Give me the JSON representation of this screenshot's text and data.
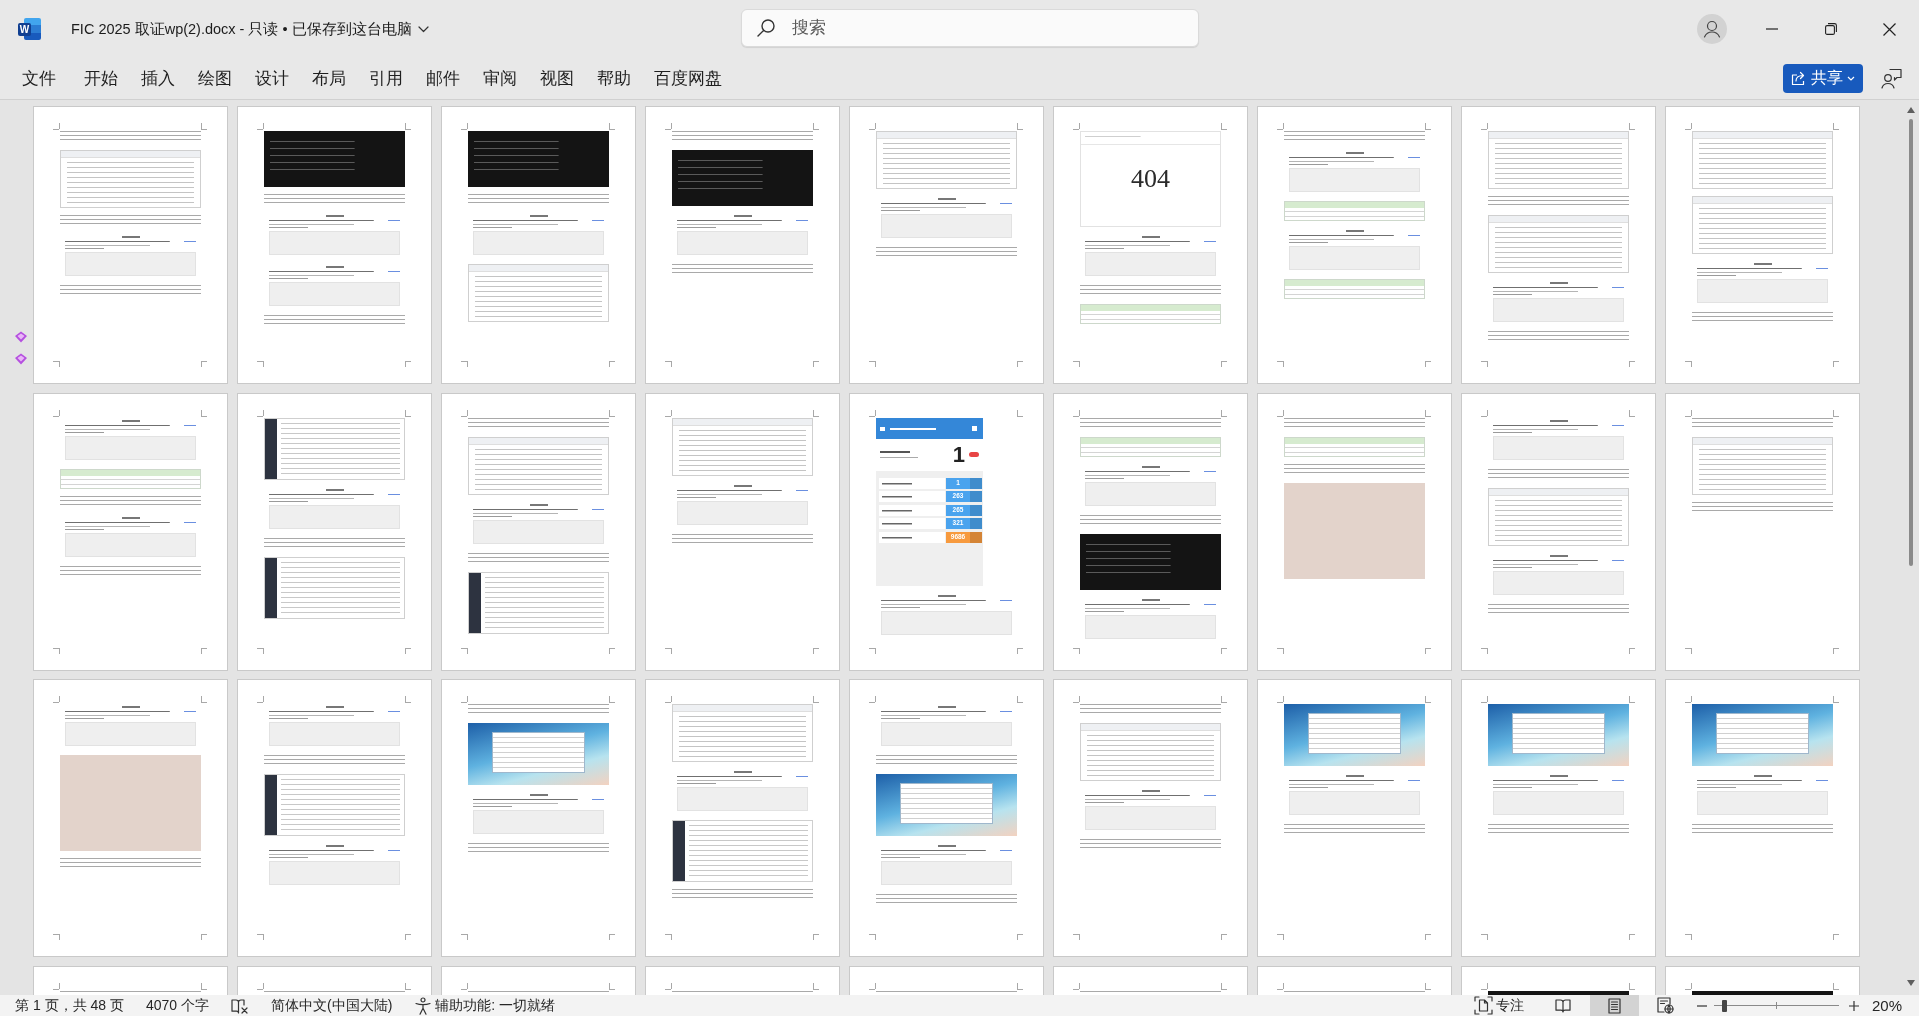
{
  "window": {
    "logo": "W",
    "title": "FIC 2025 取证wp(2).docx - 只读 • 已保存到这台电脑"
  },
  "search": {
    "placeholder": "搜索"
  },
  "ribbon": {
    "tabs": [
      {
        "label": "文件",
        "selected": false
      },
      {
        "label": "开始",
        "selected": false
      },
      {
        "label": "插入",
        "selected": false
      },
      {
        "label": "绘图",
        "selected": false
      },
      {
        "label": "设计",
        "selected": false
      },
      {
        "label": "布局",
        "selected": false
      },
      {
        "label": "引用",
        "selected": false
      },
      {
        "label": "邮件",
        "selected": false
      },
      {
        "label": "审阅",
        "selected": false
      },
      {
        "label": "视图",
        "selected": false
      },
      {
        "label": "帮助",
        "selected": false
      },
      {
        "label": "百度网盘",
        "selected": false
      }
    ],
    "share": "共享"
  },
  "document": {
    "pages": [
      {
        "blocks": [
          {
            "kind": "text"
          },
          {
            "kind": "shot"
          },
          {
            "kind": "text"
          },
          {
            "kind": "quiz"
          },
          {
            "kind": "text"
          }
        ]
      },
      {
        "blocks": [
          {
            "kind": "dark"
          },
          {
            "kind": "text"
          },
          {
            "kind": "quiz"
          },
          {
            "kind": "quiz"
          },
          {
            "kind": "text"
          }
        ]
      },
      {
        "blocks": [
          {
            "kind": "dark"
          },
          {
            "kind": "text"
          },
          {
            "kind": "quiz"
          },
          {
            "kind": "shot"
          }
        ]
      },
      {
        "blocks": [
          {
            "kind": "text"
          },
          {
            "kind": "dark"
          },
          {
            "kind": "quiz"
          },
          {
            "kind": "text"
          }
        ]
      },
      {
        "blocks": [
          {
            "kind": "shot"
          },
          {
            "kind": "quiz"
          },
          {
            "kind": "text"
          }
        ]
      },
      {
        "blocks": [
          {
            "kind": "error",
            "text": "404"
          },
          {
            "kind": "quiz"
          },
          {
            "kind": "text"
          },
          {
            "kind": "table"
          }
        ]
      },
      {
        "blocks": [
          {
            "kind": "text"
          },
          {
            "kind": "quiz"
          },
          {
            "kind": "table"
          },
          {
            "kind": "quiz"
          },
          {
            "kind": "table"
          }
        ]
      },
      {
        "blocks": [
          {
            "kind": "shot"
          },
          {
            "kind": "text"
          },
          {
            "kind": "shot"
          },
          {
            "kind": "quiz"
          },
          {
            "kind": "text"
          }
        ]
      },
      {
        "blocks": [
          {
            "kind": "shot"
          },
          {
            "kind": "shot"
          },
          {
            "kind": "quiz"
          },
          {
            "kind": "text"
          }
        ]
      },
      {
        "blocks": [
          {
            "kind": "quiz"
          },
          {
            "kind": "table"
          },
          {
            "kind": "text"
          },
          {
            "kind": "quiz"
          },
          {
            "kind": "text"
          }
        ]
      },
      {
        "blocks": [
          {
            "kind": "sidebar"
          },
          {
            "kind": "quiz"
          },
          {
            "kind": "text"
          },
          {
            "kind": "sidebar"
          }
        ]
      },
      {
        "blocks": [
          {
            "kind": "text"
          },
          {
            "kind": "shot"
          },
          {
            "kind": "quiz"
          },
          {
            "kind": "text"
          },
          {
            "kind": "sidebar"
          }
        ]
      },
      {
        "blocks": [
          {
            "kind": "shot"
          },
          {
            "kind": "quiz"
          },
          {
            "kind": "text"
          }
        ]
      },
      {
        "blocks": [
          {
            "kind": "app",
            "number": "1",
            "rows": [
              {
                "count": "1",
                "color": "#4aa3ee"
              },
              {
                "count": "263",
                "color": "#4aa3ee"
              },
              {
                "count": "265",
                "color": "#4aa3ee"
              },
              {
                "count": "321",
                "color": "#4aa3ee"
              },
              {
                "count": "9686",
                "color": "#f79a3e"
              }
            ]
          },
          {
            "kind": "quiz"
          }
        ]
      },
      {
        "blocks": [
          {
            "kind": "text"
          },
          {
            "kind": "table"
          },
          {
            "kind": "quiz"
          },
          {
            "kind": "text"
          },
          {
            "kind": "dark"
          },
          {
            "kind": "quiz"
          }
        ]
      },
      {
        "blocks": [
          {
            "kind": "text"
          },
          {
            "kind": "table"
          },
          {
            "kind": "text"
          },
          {
            "kind": "photo"
          }
        ]
      },
      {
        "blocks": [
          {
            "kind": "quiz"
          },
          {
            "kind": "text"
          },
          {
            "kind": "shot"
          },
          {
            "kind": "quiz"
          },
          {
            "kind": "text"
          }
        ]
      },
      {
        "blocks": [
          {
            "kind": "text"
          },
          {
            "kind": "shot"
          },
          {
            "kind": "text"
          }
        ]
      },
      {
        "blocks": [
          {
            "kind": "quiz"
          },
          {
            "kind": "photo"
          },
          {
            "kind": "text"
          }
        ]
      },
      {
        "blocks": [
          {
            "kind": "quiz"
          },
          {
            "kind": "text"
          },
          {
            "kind": "sidebar"
          },
          {
            "kind": "quiz"
          }
        ]
      },
      {
        "blocks": [
          {
            "kind": "text"
          },
          {
            "kind": "desktop"
          },
          {
            "kind": "quiz"
          },
          {
            "kind": "text"
          }
        ]
      },
      {
        "blocks": [
          {
            "kind": "shot"
          },
          {
            "kind": "quiz"
          },
          {
            "kind": "sidebar"
          },
          {
            "kind": "text"
          }
        ]
      },
      {
        "blocks": [
          {
            "kind": "quiz"
          },
          {
            "kind": "text"
          },
          {
            "kind": "desktop"
          },
          {
            "kind": "quiz"
          },
          {
            "kind": "text"
          }
        ]
      },
      {
        "blocks": [
          {
            "kind": "text"
          },
          {
            "kind": "shot"
          },
          {
            "kind": "quiz"
          },
          {
            "kind": "text"
          }
        ]
      },
      {
        "blocks": [
          {
            "kind": "desktop"
          },
          {
            "kind": "quiz"
          },
          {
            "kind": "text"
          }
        ]
      },
      {
        "blocks": [
          {
            "kind": "desktop"
          },
          {
            "kind": "quiz"
          },
          {
            "kind": "text"
          }
        ]
      },
      {
        "blocks": [
          {
            "kind": "desktop"
          },
          {
            "kind": "quiz"
          },
          {
            "kind": "text"
          }
        ]
      },
      {
        "blocks": [
          {
            "kind": "text"
          }
        ]
      },
      {
        "blocks": [
          {
            "kind": "text"
          }
        ]
      },
      {
        "blocks": [
          {
            "kind": "text"
          }
        ]
      },
      {
        "blocks": [
          {
            "kind": "text"
          }
        ]
      },
      {
        "blocks": [
          {
            "kind": "text"
          }
        ]
      },
      {
        "blocks": [
          {
            "kind": "text"
          }
        ]
      },
      {
        "blocks": [
          {
            "kind": "text"
          }
        ]
      },
      {
        "blocks": [
          {
            "kind": "dark"
          }
        ]
      },
      {
        "blocks": [
          {
            "kind": "dark"
          }
        ]
      }
    ]
  },
  "status_bar": {
    "page": "第 1 页，共 48 页",
    "words": "4070 个字",
    "language": "简体中文(中国大陆)",
    "accessibility": "辅助功能: 一切就绪",
    "focus": "专注",
    "views": [
      {
        "kind": "read",
        "selected": false
      },
      {
        "kind": "print",
        "selected": true
      },
      {
        "kind": "web",
        "selected": false
      }
    ],
    "zoom": {
      "level": 0.08,
      "reading": "20%"
    }
  }
}
